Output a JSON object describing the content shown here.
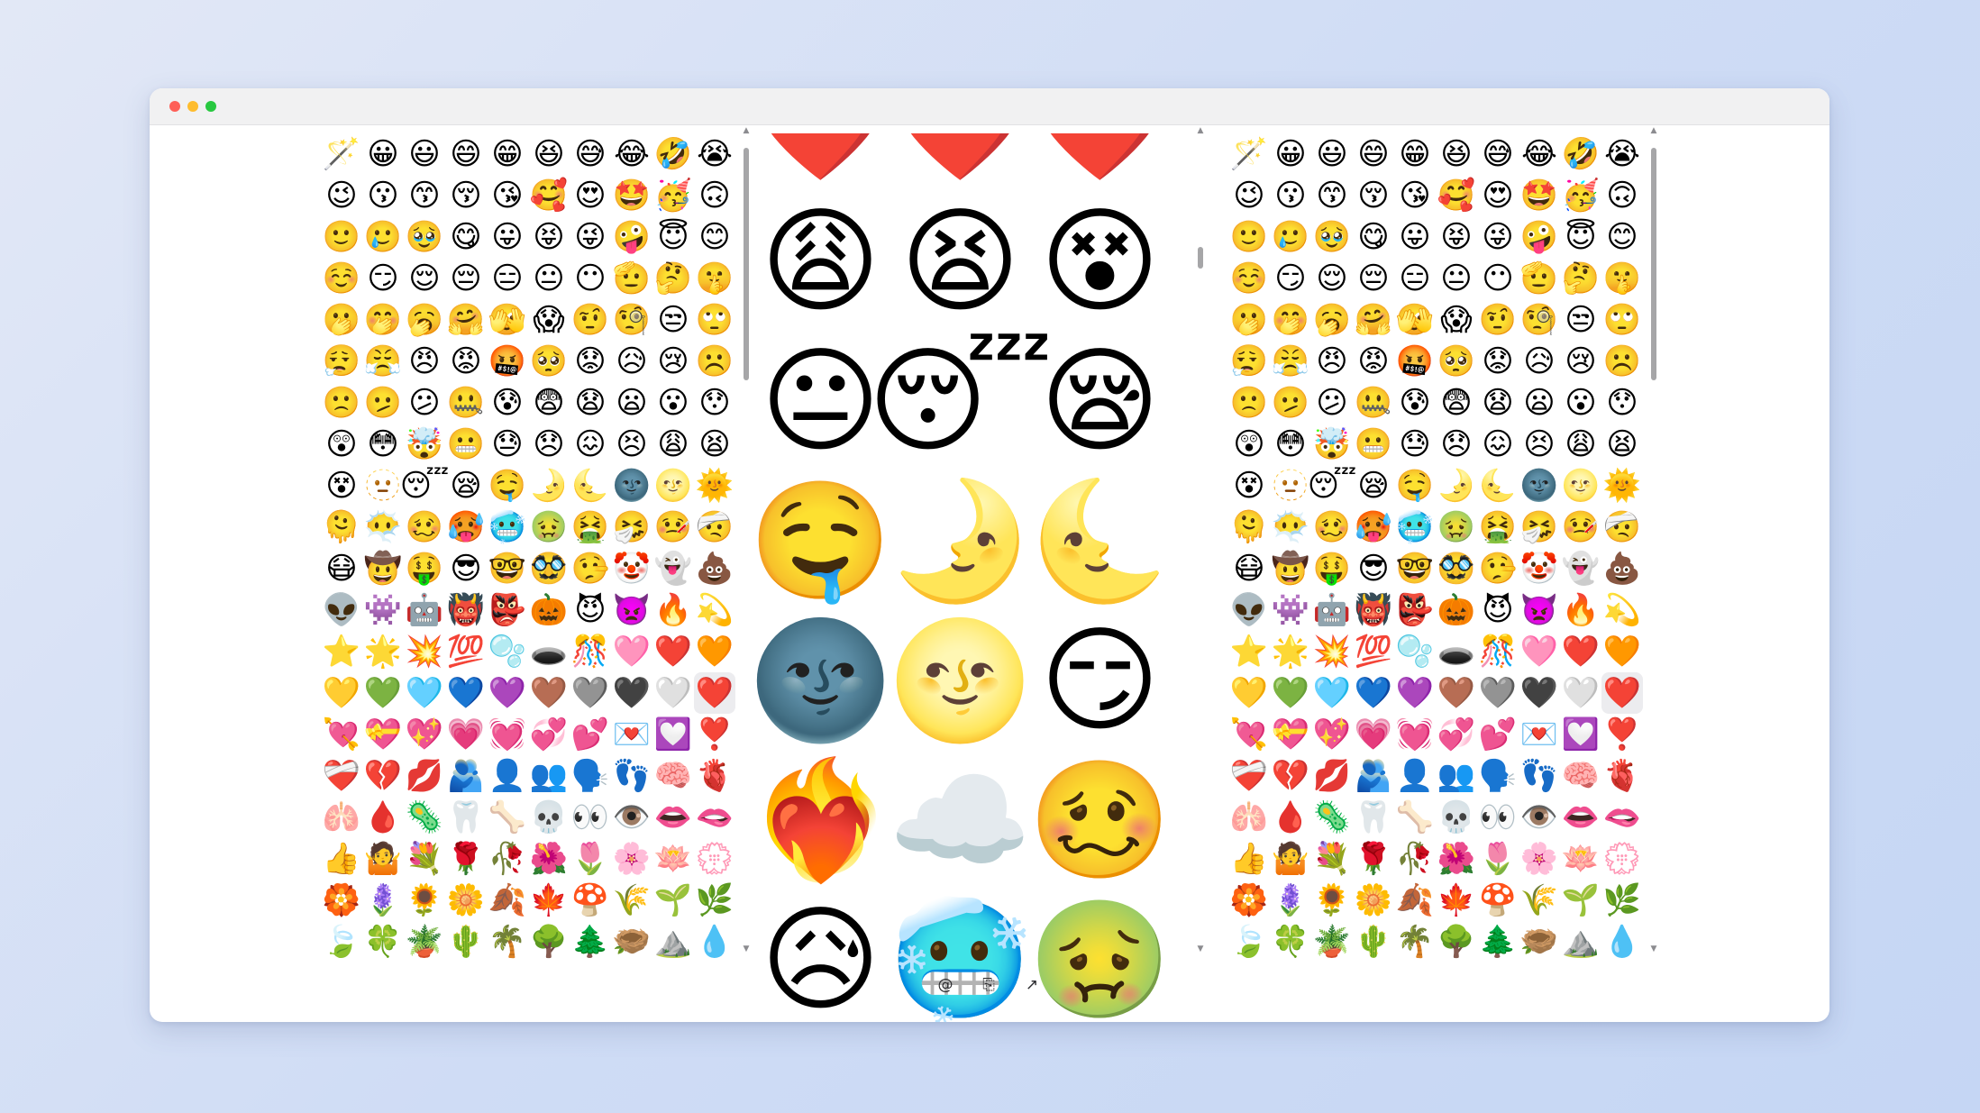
{
  "window": {
    "title_dots": [
      "close",
      "minimize",
      "maximize"
    ]
  },
  "left_panel": {
    "emojis": [
      "🪄",
      "😀",
      "😃",
      "😄",
      "😁",
      "😆",
      "😅",
      "😂",
      "🤣",
      "😭",
      "😉",
      "😗",
      "😙",
      "😚",
      "😘",
      "🥰",
      "😍",
      "🤩",
      "🥳",
      "🙃",
      "🙂",
      "🥲",
      "🥹",
      "😋",
      "😛",
      "😝",
      "😜",
      "🤪",
      "😇",
      "😊",
      "☺️",
      "😏",
      "😌",
      "😔",
      "😑",
      "😐",
      "😶",
      "🫡",
      "🤔",
      "🤫",
      "🫢",
      "🤭",
      "🥱",
      "🤗",
      "🫣",
      "😱",
      "🤨",
      "🧐",
      "😒",
      "🙄",
      "😮‍💨",
      "😤",
      "😠",
      "😡",
      "🤬",
      "🥺",
      "😟",
      "😥",
      "😢",
      "☹️",
      "🙁",
      "🫤",
      "😕",
      "🤐",
      "😰",
      "😨",
      "😧",
      "😦",
      "😮",
      "😯",
      "😲",
      "😳",
      "🤯",
      "😬",
      "😓",
      "😞",
      "😖",
      "😣",
      "😩",
      "😫",
      "😵",
      "🫥",
      "😴",
      "😪",
      "🤤",
      "🌛",
      "🌜",
      "🌚",
      "🌝",
      "🌞",
      "🫠",
      "😶‍🌫️",
      "🥴",
      "🥵",
      "🥶",
      "🤢",
      "🤮",
      "🤧",
      "🤒",
      "🤕",
      "😷",
      "🤠",
      "🤑",
      "😎",
      "🤓",
      "🥸",
      "🤥",
      "🤡",
      "👻",
      "💩",
      "👽",
      "👾",
      "🤖",
      "👹",
      "👺",
      "🎃",
      "😈",
      "👿",
      "🔥",
      "💫",
      "⭐",
      "🌟",
      "💥",
      "💯",
      "🫧",
      "🕳️",
      "🎊",
      "🩷",
      "❤️",
      "🧡",
      "💛",
      "💚",
      "🩵",
      "💙",
      "💜",
      "🤎",
      "🩶",
      "🖤",
      "🤍",
      "❤️",
      "💘",
      "💝",
      "💖",
      "💗",
      "💓",
      "💞",
      "💕",
      "💌",
      "💟",
      "❣️",
      "❤️‍🩹",
      "💔",
      "💋",
      "🫂",
      "👤",
      "👥",
      "🗣️",
      "👣",
      "🧠",
      "🫀",
      "🫁",
      "🩸",
      "🦠",
      "🦷",
      "🦴",
      "💀",
      "👀",
      "👁️",
      "👄",
      "🫦",
      "👍",
      "🤷",
      "💐",
      "🌹",
      "🥀",
      "🌺",
      "🌷",
      "🌸",
      "🪷",
      "💮",
      "🏵️",
      "🪻",
      "🌻",
      "🌼",
      "🍂",
      "🍁",
      "🍄",
      "🌾",
      "🌱",
      "🌿",
      "🍃",
      "🍀",
      "🪴",
      "🌵",
      "🌴",
      "🌳",
      "🌲",
      "🪹",
      "⛰️",
      "💧"
    ]
  },
  "center_panel": {
    "mixes": [
      "❤️",
      "❤️",
      "❤️",
      "😩",
      "😫",
      "😵",
      "😐",
      "😴",
      "😪",
      "🤤",
      "🌛",
      "🌜",
      "🌚",
      "🌝",
      "😏",
      "❤️‍🔥",
      "☁️",
      "🥴",
      "😥",
      "🥶",
      "🤢"
    ]
  },
  "right_panel": {
    "emojis": [
      "🪄",
      "😀",
      "😃",
      "😄",
      "😁",
      "😆",
      "😅",
      "😂",
      "🤣",
      "😭",
      "😉",
      "😗",
      "😙",
      "😚",
      "😘",
      "🥰",
      "😍",
      "🤩",
      "🥳",
      "🙃",
      "🙂",
      "🥲",
      "🥹",
      "😋",
      "😛",
      "😝",
      "😜",
      "🤪",
      "😇",
      "😊",
      "☺️",
      "😏",
      "😌",
      "😔",
      "😑",
      "😐",
      "😶",
      "🫡",
      "🤔",
      "🤫",
      "🫢",
      "🤭",
      "🥱",
      "🤗",
      "🫣",
      "😱",
      "🤨",
      "🧐",
      "😒",
      "🙄",
      "😮‍💨",
      "😤",
      "😠",
      "😡",
      "🤬",
      "🥺",
      "😟",
      "😥",
      "😢",
      "☹️",
      "🙁",
      "🫤",
      "😕",
      "🤐",
      "😰",
      "😨",
      "😧",
      "😦",
      "😮",
      "😯",
      "😲",
      "😳",
      "🤯",
      "😬",
      "😓",
      "😞",
      "😖",
      "😣",
      "😩",
      "😫",
      "😵",
      "🫥",
      "😴",
      "😪",
      "🤤",
      "🌛",
      "🌜",
      "🌚",
      "🌝",
      "🌞",
      "🫠",
      "😶‍🌫️",
      "🥴",
      "🥵",
      "🥶",
      "🤢",
      "🤮",
      "🤧",
      "🤒",
      "🤕",
      "😷",
      "🤠",
      "🤑",
      "😎",
      "🤓",
      "🥸",
      "🤥",
      "🤡",
      "👻",
      "💩",
      "👽",
      "👾",
      "🤖",
      "👹",
      "👺",
      "🎃",
      "😈",
      "👿",
      "🔥",
      "💫",
      "⭐",
      "🌟",
      "💥",
      "💯",
      "🫧",
      "🕳️",
      "🎊",
      "🩷",
      "❤️",
      "🧡",
      "💛",
      "💚",
      "🩵",
      "💙",
      "💜",
      "🤎",
      "🩶",
      "🖤",
      "🤍",
      "❤️",
      "💘",
      "💝",
      "💖",
      "💗",
      "💓",
      "💞",
      "💕",
      "💌",
      "💟",
      "❣️",
      "❤️‍🩹",
      "💔",
      "💋",
      "🫂",
      "👤",
      "👥",
      "🗣️",
      "👣",
      "🧠",
      "🫀",
      "🫁",
      "🩸",
      "🦠",
      "🦷",
      "🦴",
      "💀",
      "👀",
      "👁️",
      "👄",
      "🫦",
      "👍",
      "🤷",
      "💐",
      "🌹",
      "🥀",
      "🌺",
      "🌷",
      "🌸",
      "🪷",
      "💮",
      "🏵️",
      "🪻",
      "🌻",
      "🌼",
      "🍂",
      "🍁",
      "🍄",
      "🌾",
      "🌱",
      "🌿",
      "🍃",
      "🍀",
      "🪴",
      "🌵",
      "🌴",
      "🌳",
      "🌲",
      "🪹",
      "⛰️",
      "💧"
    ]
  },
  "bottom_bar": {
    "buttons": [
      {
        "icon": "at-sign-icon",
        "glyph": "@"
      },
      {
        "icon": "copy-code-icon",
        "glyph": "⎘"
      },
      {
        "icon": "external-link-icon",
        "glyph": "↗"
      }
    ]
  },
  "colors": {
    "background_start": "#e2e8f6",
    "background_end": "#c5d6f4",
    "window": "#ffffff",
    "titlebar": "#f1f1f2",
    "scroll_thumb": "#a6a6a8",
    "selected_cell": "#ececef"
  }
}
